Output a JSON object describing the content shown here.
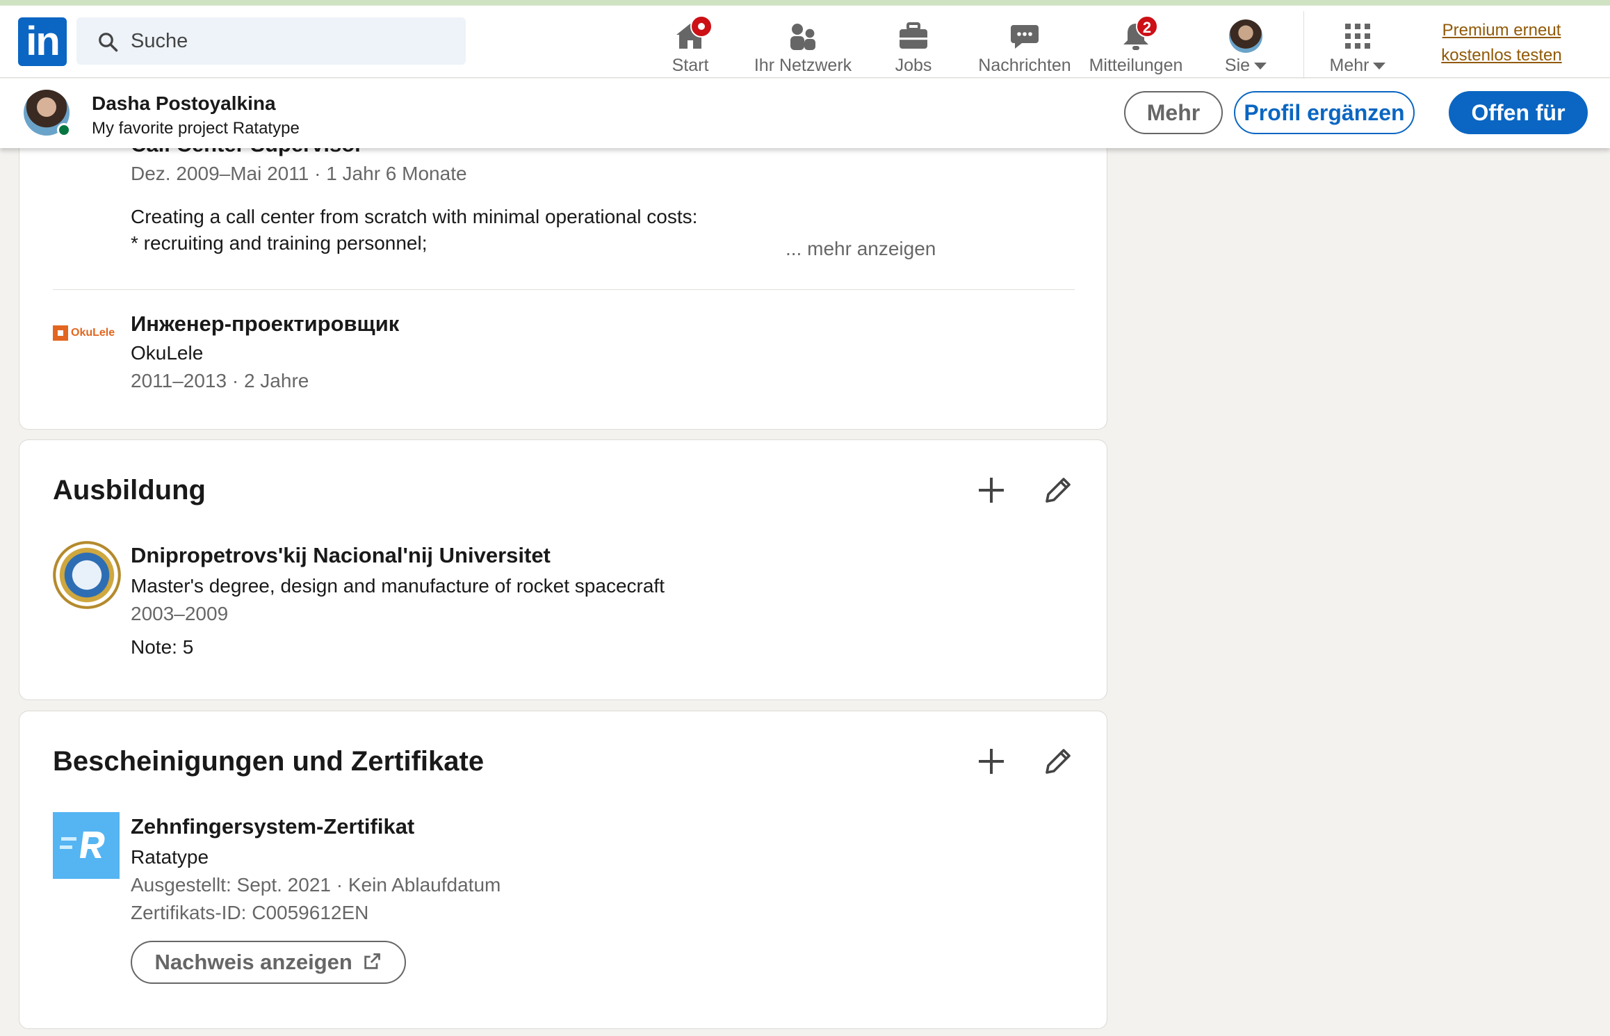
{
  "nav": {
    "logo_text": "in",
    "search_placeholder": "Suche",
    "items": [
      {
        "label": "Start",
        "icon": "home-icon",
        "badge": ""
      },
      {
        "label": "Ihr Netzwerk",
        "icon": "network-icon",
        "badge": ""
      },
      {
        "label": "Jobs",
        "icon": "briefcase-icon",
        "badge": ""
      },
      {
        "label": "Nachrichten",
        "icon": "messaging-icon",
        "badge": ""
      },
      {
        "label": "Mitteilungen",
        "icon": "bell-icon",
        "badge": "2"
      },
      {
        "label": "Sie",
        "icon": "avatar",
        "badge": ""
      },
      {
        "label": "Mehr",
        "icon": "apps-grid-icon",
        "badge": ""
      }
    ],
    "premium_line1": "Premium erneut",
    "premium_line2": "kostenlos testen"
  },
  "profile_bar": {
    "name": "Dasha Postoyalkina",
    "headline": "My favorite project Ratatype",
    "btn_mehr": "Mehr",
    "btn_profil": "Profil ergänzen",
    "btn_offen": "Offen für"
  },
  "experience": {
    "partial_title": "Call Center Supervisor",
    "partial_dates": "Dez. 2009–Mai 2011 · 1 Jahr 6 Monate",
    "partial_desc_1": "Creating a call center from scratch with minimal operational costs:",
    "partial_desc_2": "* recruiting and training personnel;",
    "show_more": "... mehr anzeigen",
    "item2_logo_text": "OkuLele",
    "item2_title": "Инженер-проектировщик",
    "item2_company": "OkuLele",
    "item2_dates": "2011–2013 · 2 Jahre"
  },
  "education": {
    "title": "Ausbildung",
    "school": "Dnipropetrovs'kij Nacional'nij Universitet",
    "degree": "Master's degree, design and manufacture of rocket spacecraft",
    "dates": "2003–2009",
    "grade": "Note: 5"
  },
  "certificates": {
    "title": "Bescheinigungen und Zertifikate",
    "name": "Zehnfingersystem-Zertifikat",
    "issuer": "Ratatype",
    "issued": "Ausgestellt: Sept. 2021 · Kein Ablaufdatum",
    "cert_id": "Zertifikats-ID: C0059612EN",
    "show_credential": "Nachweis anzeigen"
  },
  "colors": {
    "brand_blue": "#0a66c2",
    "notification_red": "#cc1016",
    "premium_gold": "#915907",
    "online_green": "#057642",
    "ratatype_blue": "#55b4f2"
  }
}
